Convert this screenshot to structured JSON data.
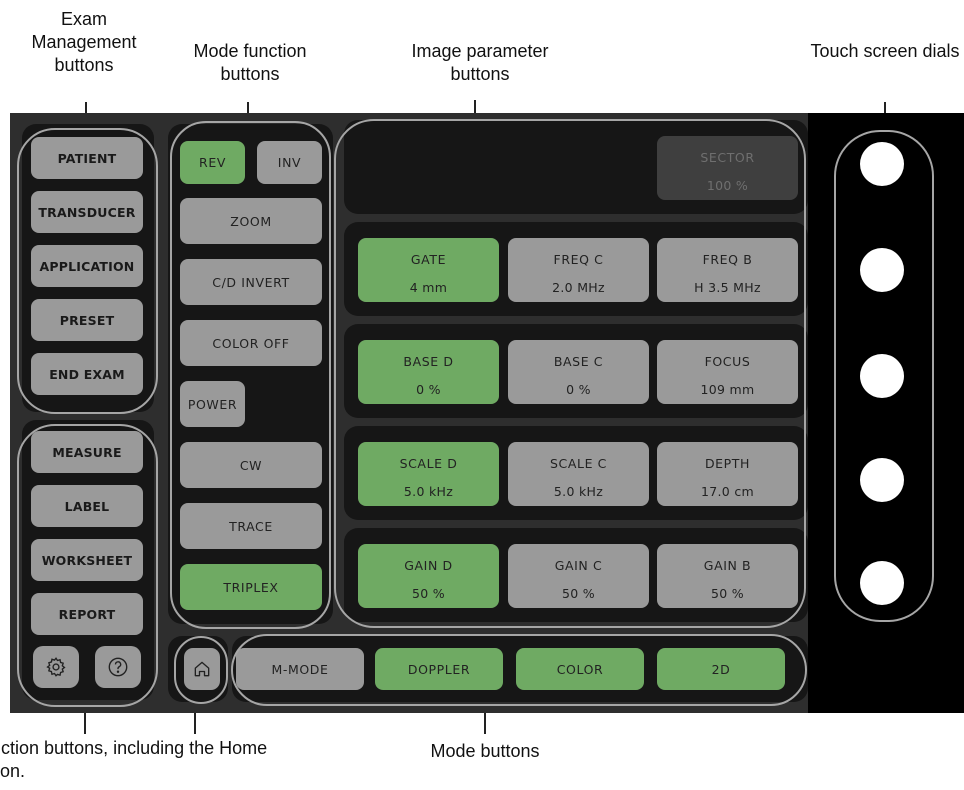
{
  "callouts": {
    "exam_management": "Exam Management buttons",
    "mode_function": "Mode function buttons",
    "image_parameter": "Image parameter buttons",
    "touch_dials": "Touch screen dials",
    "function_buttons": "Function buttons, including the Home button.",
    "mode_buttons": "Mode buttons"
  },
  "exam_buttons": [
    "PATIENT",
    "TRANSDUCER",
    "APPLICATION",
    "PRESET",
    "END EXAM"
  ],
  "function_buttons": [
    "MEASURE",
    "LABEL",
    "WORKSHEET",
    "REPORT"
  ],
  "mode_function": {
    "rev": "REV",
    "inv": "INV",
    "zoom": "ZOOM",
    "cd_invert": "C/D INVERT",
    "color_off": "COLOR OFF",
    "power": "POWER",
    "cw": "CW",
    "trace": "TRACE",
    "triplex": "TRIPLEX"
  },
  "image_parameters": {
    "sector": {
      "name": "SECTOR",
      "value": "100 %",
      "state": "disabled"
    },
    "rows": [
      [
        {
          "name": "GATE",
          "value": "4 mm",
          "state": "active"
        },
        {
          "name": "FREQ C",
          "value": "2.0 MHz",
          "state": "normal"
        },
        {
          "name": "FREQ B",
          "value": "H 3.5 MHz",
          "state": "normal"
        }
      ],
      [
        {
          "name": "BASE D",
          "value": "0 %",
          "state": "active"
        },
        {
          "name": "BASE C",
          "value": "0 %",
          "state": "normal"
        },
        {
          "name": "FOCUS",
          "value": "109 mm",
          "state": "normal"
        }
      ],
      [
        {
          "name": "SCALE D",
          "value": "5.0 kHz",
          "state": "active"
        },
        {
          "name": "SCALE C",
          "value": "5.0 kHz",
          "state": "normal"
        },
        {
          "name": "DEPTH",
          "value": "17.0 cm",
          "state": "normal"
        }
      ],
      [
        {
          "name": "GAIN D",
          "value": "50 %",
          "state": "active"
        },
        {
          "name": "GAIN C",
          "value": "50 %",
          "state": "normal"
        },
        {
          "name": "GAIN B",
          "value": "50 %",
          "state": "normal"
        }
      ]
    ]
  },
  "mode_buttons": [
    "M-MODE",
    "DOPPLER",
    "COLOR",
    "2D"
  ],
  "icons": {
    "settings": "gear-icon",
    "help": "question-mark-icon",
    "home": "home-icon"
  },
  "colors": {
    "active": "#6faa63",
    "normal": "#9a9a9a",
    "disabled": "#3f3f3f",
    "panel": "#161616",
    "outline": "#a6a6a6"
  }
}
